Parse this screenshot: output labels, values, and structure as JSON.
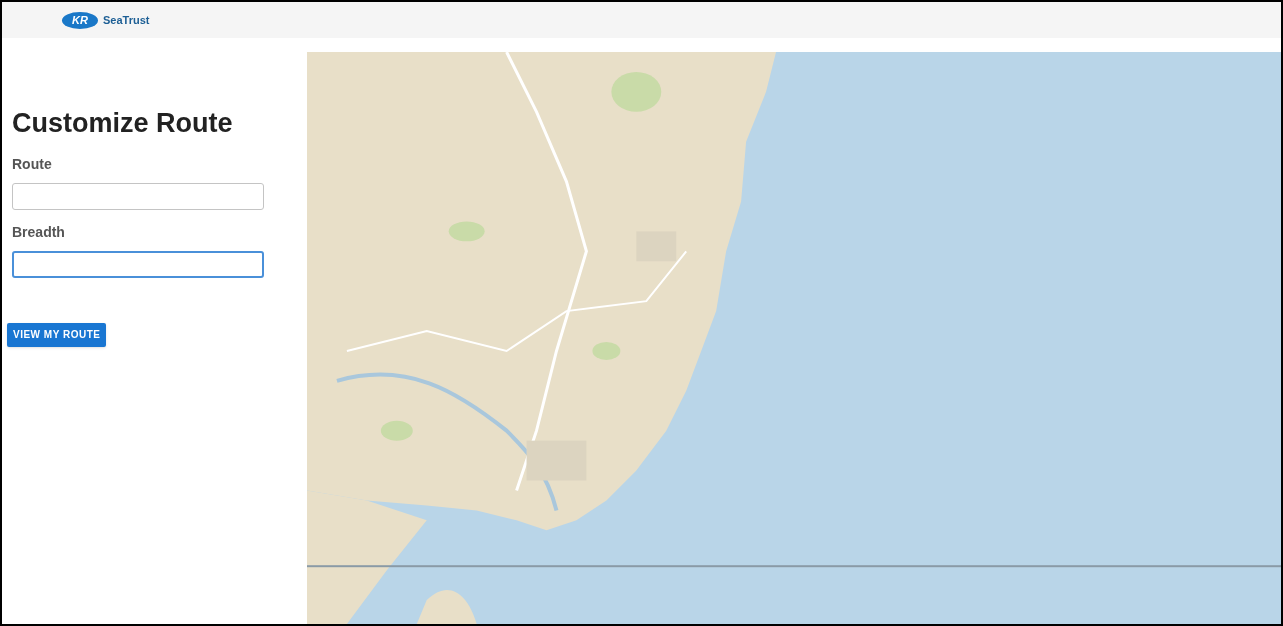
{
  "header": {
    "logo_text": "KR",
    "brand": "SeaTrust"
  },
  "form": {
    "title": "Customize Route",
    "fields": [
      {
        "label": "Route",
        "focused": false
      },
      {
        "label": "Breadth",
        "focused": true
      }
    ],
    "button": "VIEW MY ROUTE"
  }
}
